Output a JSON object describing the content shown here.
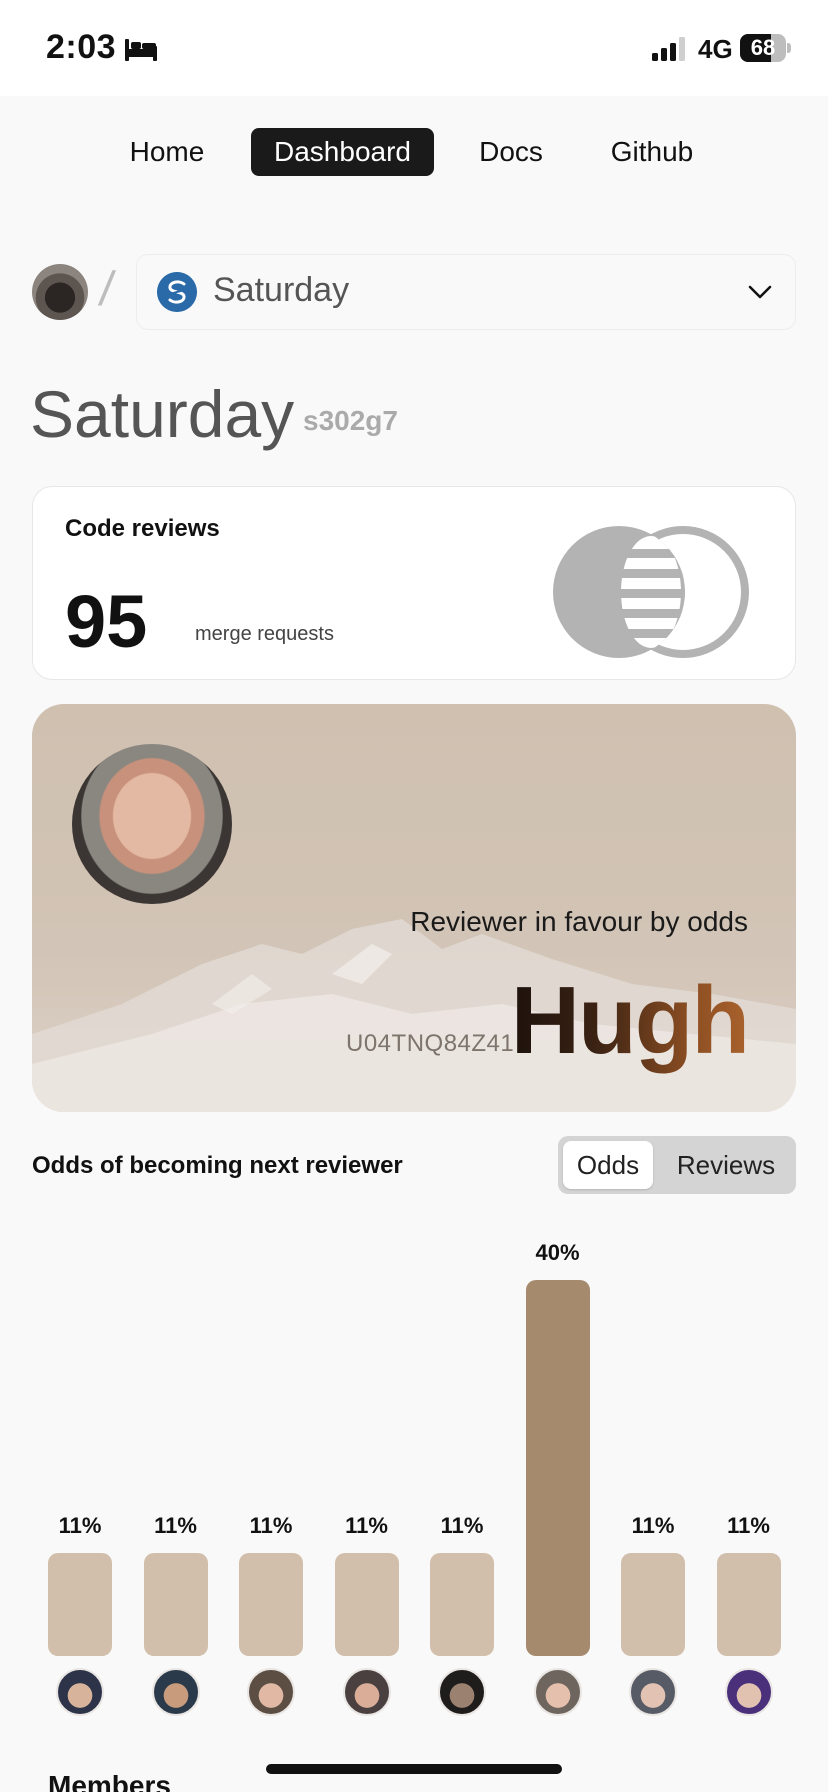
{
  "status_bar": {
    "time": "2:03",
    "network": "4G",
    "battery": "68",
    "battery_level": 0.68,
    "icons": [
      "bed-icon",
      "signal-icon",
      "battery-icon"
    ]
  },
  "nav": {
    "items": [
      {
        "label": "Home"
      },
      {
        "label": "Dashboard",
        "active": true
      },
      {
        "label": "Docs"
      },
      {
        "label": "Github"
      }
    ]
  },
  "project": {
    "selected": "Saturday",
    "title": "Saturday",
    "id": "s302g7"
  },
  "reviews_card": {
    "heading": "Code reviews",
    "count": "95",
    "unit": "merge requests",
    "icon": "merge-icon"
  },
  "featured": {
    "label": "Reviewer in favour by odds",
    "user_id": "U04TNQ84Z41",
    "name": "Hugh"
  },
  "odds": {
    "heading": "Odds of becoming next reviewer",
    "toggle": [
      {
        "label": "Odds",
        "active": true
      },
      {
        "label": "Reviews"
      }
    ]
  },
  "chart_data": {
    "type": "bar",
    "categories": [
      "1",
      "2",
      "3",
      "4",
      "5",
      "6",
      "7",
      "8"
    ],
    "values": [
      11,
      11,
      11,
      11,
      11,
      40,
      11,
      11
    ],
    "labels": [
      "11%",
      "11%",
      "11%",
      "11%",
      "11%",
      "40%",
      "11%",
      "11%"
    ],
    "ylim": [
      0,
      40
    ],
    "highlight_index": 5,
    "colors": {
      "bar": "#d1bfac",
      "highlight": "#a68a6d"
    }
  },
  "members": {
    "heading": "Members"
  }
}
